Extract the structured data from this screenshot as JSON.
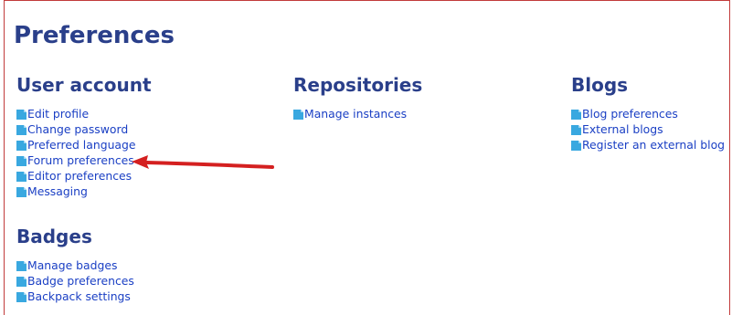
{
  "page": {
    "title": "Preferences"
  },
  "sections": {
    "user_account": {
      "heading": "User account",
      "links": [
        "Edit profile",
        "Change password",
        "Preferred language",
        "Forum preferences",
        "Editor preferences",
        "Messaging"
      ]
    },
    "repositories": {
      "heading": "Repositories",
      "links": [
        "Manage instances"
      ]
    },
    "blogs": {
      "heading": "Blogs",
      "links": [
        "Blog preferences",
        "External blogs",
        "Register an external blog"
      ]
    },
    "badges": {
      "heading": "Badges",
      "links": [
        "Manage badges",
        "Badge preferences",
        "Backpack settings"
      ]
    }
  },
  "annotation": {
    "arrow_color": "#d42020",
    "points_to": "Forum preferences"
  },
  "colors": {
    "heading": "#2a3f8a",
    "link": "#1a3fc4",
    "icon": "#39a8e0",
    "frame_border": "#c23b3b"
  }
}
